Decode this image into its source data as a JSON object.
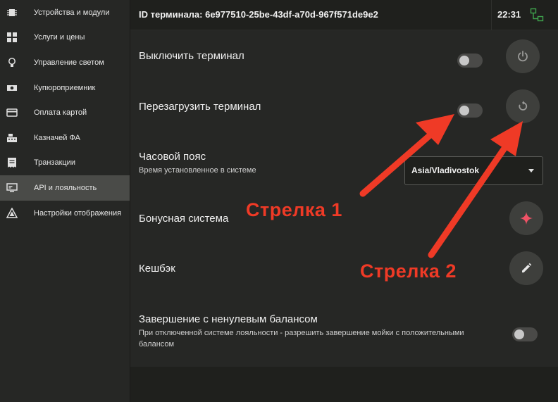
{
  "sidebar": {
    "items": [
      {
        "label": "Устройства и модули",
        "icon": "chip-icon",
        "active": false
      },
      {
        "label": "Услуги и цены",
        "icon": "grid-icon",
        "active": false
      },
      {
        "label": "Управление светом",
        "icon": "bulb-icon",
        "active": false
      },
      {
        "label": "Купюроприемник",
        "icon": "banknote-icon",
        "active": false
      },
      {
        "label": "Оплата картой",
        "icon": "card-icon",
        "active": false
      },
      {
        "label": "Казначей ФА",
        "icon": "cash-register-icon",
        "active": false
      },
      {
        "label": "Транзакции",
        "icon": "receipt-icon",
        "active": false
      },
      {
        "label": "API и лояльность",
        "icon": "api-icon",
        "active": true
      },
      {
        "label": "Настройки отображения",
        "icon": "display-settings-icon",
        "active": false
      }
    ]
  },
  "header": {
    "terminal_id": "ID терминала: 6e977510-25be-43df-a70d-967f571de9e2",
    "time": "22:31",
    "status_icon": "network-icon",
    "status_color": "#3fa34d"
  },
  "settings": {
    "shutdown": {
      "title": "Выключить терминал",
      "toggle_on": false,
      "icon": "power-icon"
    },
    "reboot": {
      "title": "Перезагрузить терминал",
      "toggle_on": false,
      "icon": "restart-icon"
    },
    "timezone": {
      "title": "Часовой пояс",
      "subtitle": "Время установленное в системе",
      "value": "Asia/Vladivostok"
    },
    "bonus": {
      "title": "Бонусная система",
      "icon": "sparkle-icon",
      "icon_color": "#f05266"
    },
    "cashback": {
      "title": "Кешбэк",
      "icon": "pencil-icon"
    },
    "nonzero": {
      "title": "Завершение с ненулевым балансом",
      "subtitle_line1": "При отключенной системе лояльности - разрешить завершение мойки с положительными",
      "subtitle_line2": "балансом",
      "toggle_on": false
    }
  },
  "annotations": {
    "arrow1_label": "Стрелка 1",
    "arrow2_label": "Стрелка 2",
    "color": "#ef3a26"
  }
}
